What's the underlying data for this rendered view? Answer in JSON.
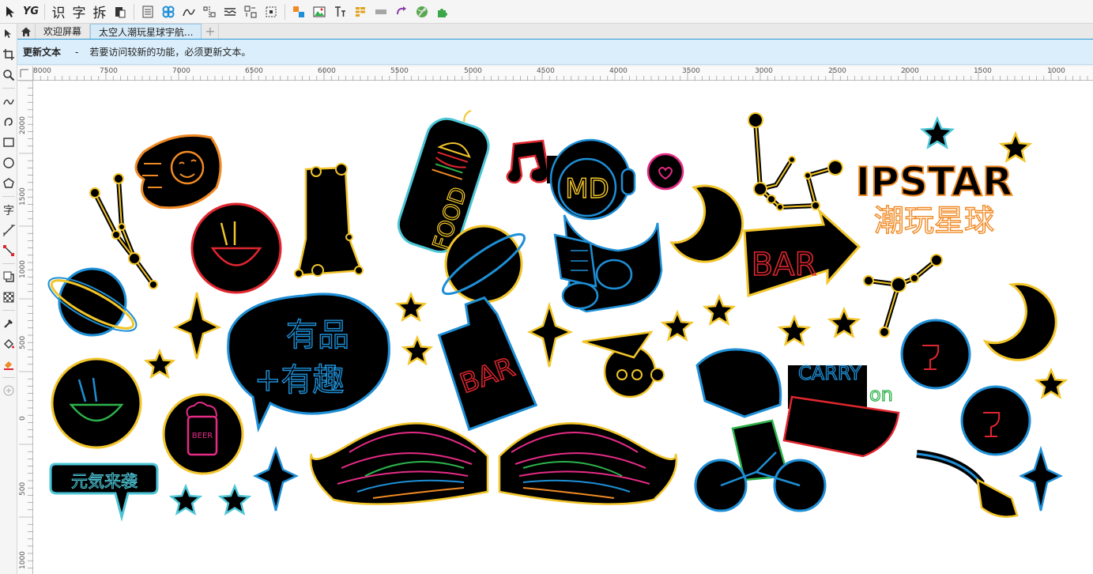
{
  "toolbar": {
    "items": [
      {
        "name": "pick-tool-icon"
      },
      {
        "name": "yg-plugin-icon",
        "label": "YG"
      },
      {
        "name": "recognize-text-button",
        "label": "识"
      },
      {
        "name": "text-button",
        "label": "字"
      },
      {
        "name": "split-button",
        "label": "拆"
      },
      {
        "name": "clipboard-icon"
      }
    ]
  },
  "tabs": {
    "welcome": "欢迎屏幕",
    "document": "太空人潮玩星球宇航..."
  },
  "notice": {
    "title": "更新文本",
    "dash": "-",
    "message": "若要访问较新的功能，必须更新文本。"
  },
  "ruler": {
    "h_labels": [
      "8000",
      "7500",
      "7000",
      "6500",
      "6000",
      "5500",
      "5000",
      "4500",
      "4000",
      "3500",
      "3000",
      "2500",
      "2000",
      "1500",
      "1000"
    ],
    "v_labels": [
      "2000",
      "1500",
      "1000",
      "500",
      "0",
      "500",
      "1000"
    ]
  },
  "artwork": {
    "ipstar": "IPSTAR",
    "ipstar_cn": "潮玩星球",
    "food": "FOOD",
    "bar1": "BAR",
    "bar2": "BAR",
    "md": "MD",
    "bubble_line1": "有品",
    "bubble_line2": "+有趣",
    "genki": "元気来袭",
    "carry": "CARRY",
    "on": "on",
    "beer": "BEER"
  },
  "colors": {
    "accent_blue": "#2a9bd4",
    "neon_blue": "#1e8fd6",
    "neon_yellow": "#f2c52a",
    "neon_orange": "#f08a24",
    "neon_red": "#e0262f",
    "neon_pink": "#e62b86",
    "neon_green": "#2db24b",
    "neon_cyan": "#4cc6d6"
  }
}
